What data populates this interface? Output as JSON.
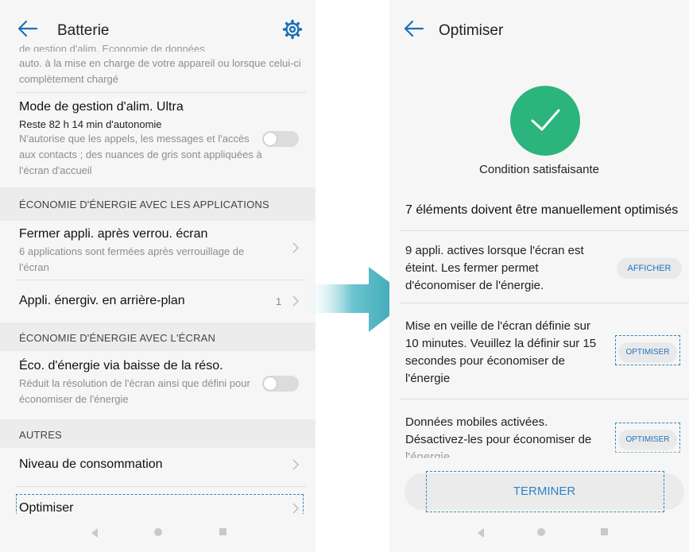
{
  "left": {
    "title": "Batterie",
    "cut_line": "de gestion d'alim. Économie de données",
    "intro_desc": "auto. à la mise en charge de votre appareil ou lorsque celui-ci complètement chargé",
    "ultra": {
      "title": "Mode de gestion d'alim. Ultra",
      "subtitle": "Reste 82 h  14 min d'autonomie",
      "desc": "N'autorise que les appels, les messages et l'accès aux contacts ; des nuances de gris sont appliquées à l'écran d'accueil",
      "toggle_on": false
    },
    "cat_apps": "ÉCONOMIE D'ÉNERGIE AVEC LES APPLICATIONS",
    "close_apps": {
      "title": "Fermer appli. après verrou. écran",
      "desc": "6 applications sont fermées après verrouillage de l'écran"
    },
    "bg_apps": {
      "title": "Appli. énergiv. en arrière-plan",
      "count": "1"
    },
    "cat_screen": "ÉCONOMIE D'ÉNERGIE AVEC L'ÉCRAN",
    "res": {
      "title": "Éco. d'énergie via baisse de la réso.",
      "desc": "Réduit la résolution de l'écran ainsi que défini pour économiser de l'énergie",
      "toggle_on": false
    },
    "cat_other": "AUTRES",
    "consumption": "Niveau de consommation",
    "optimize": "Optimiser"
  },
  "right": {
    "title": "Optimiser",
    "status": "Condition satisfaisante",
    "list_header": "7 éléments doivent être manuellement optimisés",
    "items": [
      {
        "text": "9 appli. actives lorsque l'écran est éteint. Les fermer permet d'économiser de l'énergie.",
        "action": "AFFICHER"
      },
      {
        "text": "Mise en veille de l'écran définie sur 10 minutes. Veuillez la définir sur 15 secondes pour économiser de l'énergie",
        "action": "OPTIMISER"
      },
      {
        "text": "Données mobiles activées. Désactivez-les pour économiser de l'énergie",
        "action": "OPTIMISER"
      }
    ],
    "finish": "TERMINER"
  },
  "colors": {
    "accent_blue": "#2f83c6",
    "success_green": "#2bb47b",
    "highlight_dash": "#2f8cb0",
    "arrow_teal": "#35a7b5"
  },
  "icons": [
    "back-arrow-icon",
    "gear-icon",
    "chevron-right-icon",
    "check-icon",
    "nav-back-icon",
    "nav-home-icon",
    "nav-recent-icon",
    "transition-arrow-icon"
  ]
}
